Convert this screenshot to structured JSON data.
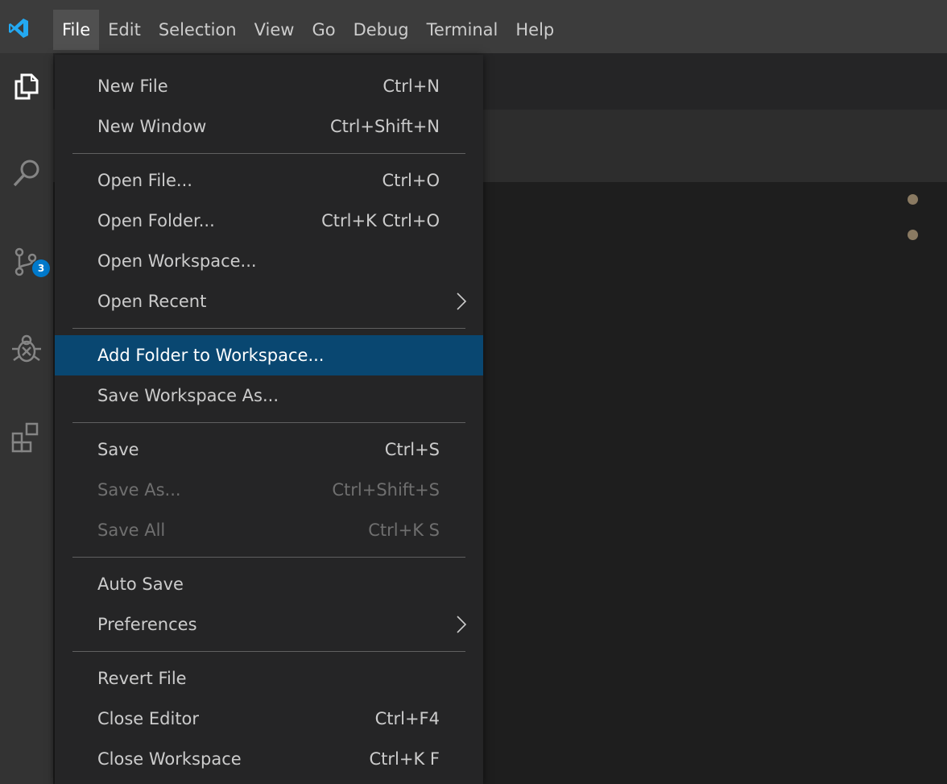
{
  "menubar": {
    "items": [
      {
        "label": "File"
      },
      {
        "label": "Edit"
      },
      {
        "label": "Selection"
      },
      {
        "label": "View"
      },
      {
        "label": "Go"
      },
      {
        "label": "Debug"
      },
      {
        "label": "Terminal"
      },
      {
        "label": "Help"
      }
    ],
    "active": "File"
  },
  "activitybar": {
    "icons": [
      "explorer-icon",
      "search-icon",
      "source-control-icon",
      "debug-icon",
      "extensions-icon"
    ],
    "source_control_badge": "3"
  },
  "file_menu": {
    "groups": [
      [
        {
          "label": "New File",
          "shortcut": "Ctrl+N"
        },
        {
          "label": "New Window",
          "shortcut": "Ctrl+Shift+N"
        }
      ],
      [
        {
          "label": "Open File...",
          "shortcut": "Ctrl+O"
        },
        {
          "label": "Open Folder...",
          "shortcut": "Ctrl+K Ctrl+O"
        },
        {
          "label": "Open Workspace...",
          "shortcut": ""
        },
        {
          "label": "Open Recent",
          "shortcut": "",
          "submenu": true
        }
      ],
      [
        {
          "label": "Add Folder to Workspace...",
          "shortcut": "",
          "highlighted": true
        },
        {
          "label": "Save Workspace As...",
          "shortcut": ""
        }
      ],
      [
        {
          "label": "Save",
          "shortcut": "Ctrl+S"
        },
        {
          "label": "Save As...",
          "shortcut": "Ctrl+Shift+S",
          "disabled": true
        },
        {
          "label": "Save All",
          "shortcut": "Ctrl+K S",
          "disabled": true
        }
      ],
      [
        {
          "label": "Auto Save",
          "shortcut": ""
        },
        {
          "label": "Preferences",
          "shortcut": "",
          "submenu": true
        }
      ],
      [
        {
          "label": "Revert File",
          "shortcut": ""
        },
        {
          "label": "Close Editor",
          "shortcut": "Ctrl+F4"
        },
        {
          "label": "Close Workspace",
          "shortcut": "Ctrl+K F"
        }
      ]
    ]
  },
  "colors": {
    "accent": "#007acc",
    "highlight": "#094771",
    "menubar_bg": "#3c3c3c",
    "menu_bg": "#252526",
    "activity_bg": "#333333",
    "editor_bg": "#1e1e1e"
  }
}
